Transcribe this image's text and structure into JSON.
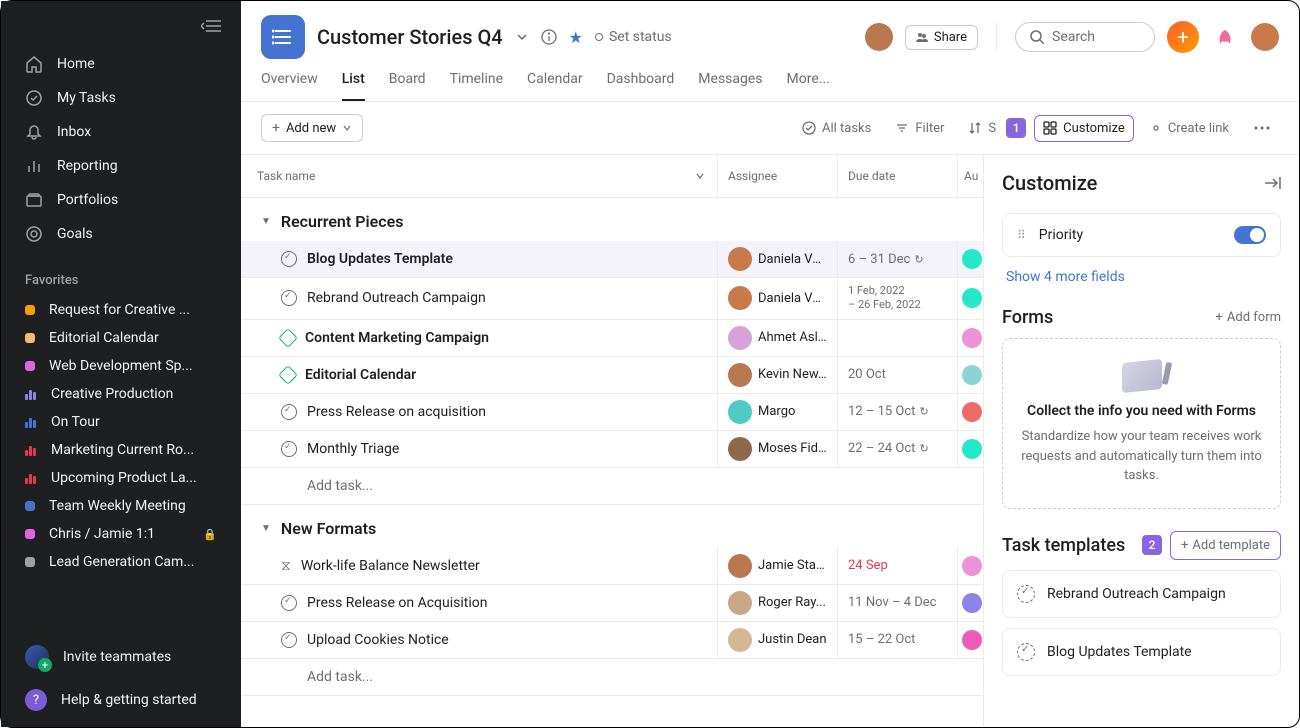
{
  "sidebar": {
    "nav": [
      {
        "label": "Home",
        "icon": "home"
      },
      {
        "label": "My Tasks",
        "icon": "check"
      },
      {
        "label": "Inbox",
        "icon": "bell"
      },
      {
        "label": "Reporting",
        "icon": "chart"
      },
      {
        "label": "Portfolios",
        "icon": "folder"
      },
      {
        "label": "Goals",
        "icon": "target"
      }
    ],
    "favorites_title": "Favorites",
    "favorites": [
      {
        "label": "Request for Creative ...",
        "type": "dot",
        "color": "#fd9a00"
      },
      {
        "label": "Editorial Calendar",
        "type": "dot",
        "color": "#f1bd6c"
      },
      {
        "label": "Web Development Sp...",
        "type": "dot",
        "color": "#e362e3"
      },
      {
        "label": "Creative Production",
        "type": "bars",
        "color": "#8d84e8"
      },
      {
        "label": "On Tour",
        "type": "bars",
        "color": "#4573d2"
      },
      {
        "label": "Marketing Current Ro...",
        "type": "bars",
        "color": "#e8384f"
      },
      {
        "label": "Upcoming Product La...",
        "type": "bars",
        "color": "#e8384f"
      },
      {
        "label": "Team Weekly Meeting",
        "type": "dot",
        "color": "#4573d2"
      },
      {
        "label": "Chris / Jamie 1:1",
        "type": "dot",
        "color": "#e362e3",
        "locked": true
      },
      {
        "label": "Lead Generation Cam...",
        "type": "dot",
        "color": "#a2a0a2"
      }
    ],
    "invite_label": "Invite teammates",
    "help_label": "Help & getting started"
  },
  "header": {
    "title": "Customer Stories Q4",
    "set_status": "Set status",
    "share": "Share",
    "search_placeholder": "Search"
  },
  "tabs": [
    "Overview",
    "List",
    "Board",
    "Timeline",
    "Calendar",
    "Dashboard",
    "Messages",
    "More..."
  ],
  "active_tab": "List",
  "toolbar": {
    "add_new": "Add new",
    "all_tasks": "All tasks",
    "filter": "Filter",
    "sort": "Sort",
    "customize": "Customize",
    "create_link": "Create link",
    "callout1": "1"
  },
  "columns": {
    "task": "Task name",
    "assignee": "Assignee",
    "due": "Due date",
    "au": "Au"
  },
  "sections": [
    {
      "name": "Recurrent Pieces",
      "tasks": [
        {
          "name": "Blog Updates Template",
          "bold": true,
          "icon": "check",
          "assignee": "Daniela Var...",
          "avatar": "#c97a4a",
          "due": "6 – 31 Dec",
          "repeat": true,
          "au": "#25e8c8",
          "selected": true
        },
        {
          "name": "Rebrand Outreach Campaign",
          "icon": "check",
          "assignee": "Daniela Var...",
          "avatar": "#c97a4a",
          "due": "1 Feb, 2022\n– 26 Feb, 2022",
          "au": "#25e8c8"
        },
        {
          "name": "Content Marketing Campaign",
          "bold": true,
          "icon": "diamond",
          "assignee": "Ahmet Aslan",
          "avatar": "#d6a3d6",
          "au": "#ec92d8"
        },
        {
          "name": "Editorial Calendar",
          "bold": true,
          "icon": "diamond",
          "assignee": "Kevin New...",
          "avatar": "#b87950",
          "due": "20 Oct",
          "au": "#8ed3d3"
        },
        {
          "name": "Press Release on acquisition",
          "icon": "check",
          "assignee": "Margo",
          "avatar": "#4ecbc4",
          "due": "12 – 15 Oct",
          "repeat": true,
          "au": "#f06a6a"
        },
        {
          "name": "Monthly Triage",
          "icon": "check",
          "assignee": "Moses Fidel",
          "avatar": "#8a6a4a",
          "due": "22 – 24 Oct",
          "repeat": true,
          "au": "#25e8c8"
        }
      ]
    },
    {
      "name": "New Formats",
      "tasks": [
        {
          "name": "Work-life Balance Newsletter",
          "icon": "hourglass",
          "assignee": "Jamie Stap...",
          "avatar": "#b87950",
          "due": "24 Sep",
          "overdue": true,
          "au": "#ec92d8"
        },
        {
          "name": "Press Release on Acquisition",
          "icon": "check",
          "assignee": "Roger Ray...",
          "avatar": "#c9a88a",
          "due": "11 Nov – 4 Dec",
          "au": "#8d84e8"
        },
        {
          "name": "Upload Cookies Notice",
          "icon": "check",
          "assignee": "Justin Dean",
          "avatar": "#d4b896",
          "due": "15 – 22 Oct",
          "au": "#ec5bb5"
        }
      ]
    }
  ],
  "add_task_placeholder": "Add task...",
  "panel": {
    "title": "Customize",
    "field_name": "Priority",
    "show_more": "Show 4 more fields",
    "forms_title": "Forms",
    "add_form": "Add form",
    "forms_box_title": "Collect the info you need with Forms",
    "forms_box_desc": "Standardize how your team receives work requests and automatically turn them into tasks.",
    "templates_title": "Task templates",
    "add_template": "Add template",
    "callout2": "2",
    "templates": [
      "Rebrand Outreach Campaign",
      "Blog Updates Template"
    ]
  }
}
